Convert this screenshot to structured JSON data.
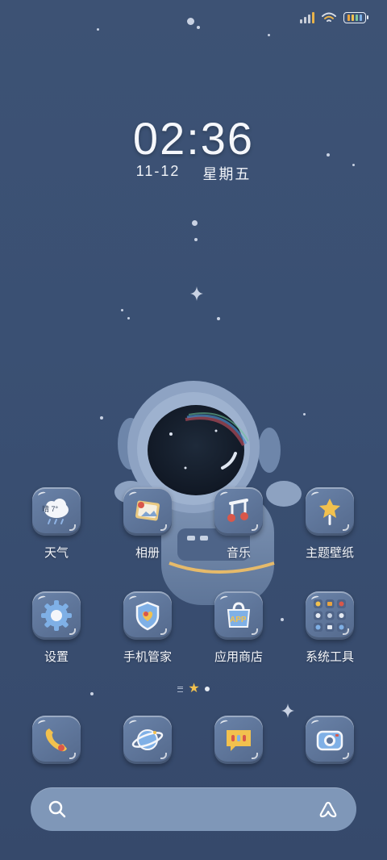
{
  "status_bar": {
    "signal_icon": "signal-icon",
    "wifi_icon": "wifi-icon",
    "battery_icon": "battery-icon",
    "battery_colors": [
      "#e8a440",
      "#f2c14e",
      "#7cc6a0",
      "#7fb0e6"
    ]
  },
  "clock": {
    "time": "02:36",
    "date": "11-12",
    "weekday": "星期五"
  },
  "apps_row1": [
    {
      "label": "天气",
      "icon": "weather-icon",
      "badge": "晴 7°"
    },
    {
      "label": "相册",
      "icon": "gallery-icon"
    },
    {
      "label": "音乐",
      "icon": "music-icon"
    },
    {
      "label": "主题壁纸",
      "icon": "theme-icon"
    }
  ],
  "apps_row2": [
    {
      "label": "设置",
      "icon": "settings-icon"
    },
    {
      "label": "手机管家",
      "icon": "security-icon"
    },
    {
      "label": "应用商店",
      "icon": "app-store-icon",
      "badge": "APP"
    },
    {
      "label": "系统工具",
      "icon": "tools-folder-icon"
    }
  ],
  "dock": [
    {
      "icon": "phone-icon"
    },
    {
      "icon": "browser-icon"
    },
    {
      "icon": "messages-icon"
    },
    {
      "icon": "camera-icon"
    }
  ],
  "page_indicator": {
    "pages": 2,
    "current": 1
  },
  "search_bar": {
    "search_icon": "search-icon",
    "assistant_icon": "assistant-icon"
  },
  "colors": {
    "background": "#3a5073",
    "icon_tile": "#5e7599",
    "accent_yellow": "#f2c14e",
    "accent_red": "#d9574a"
  }
}
